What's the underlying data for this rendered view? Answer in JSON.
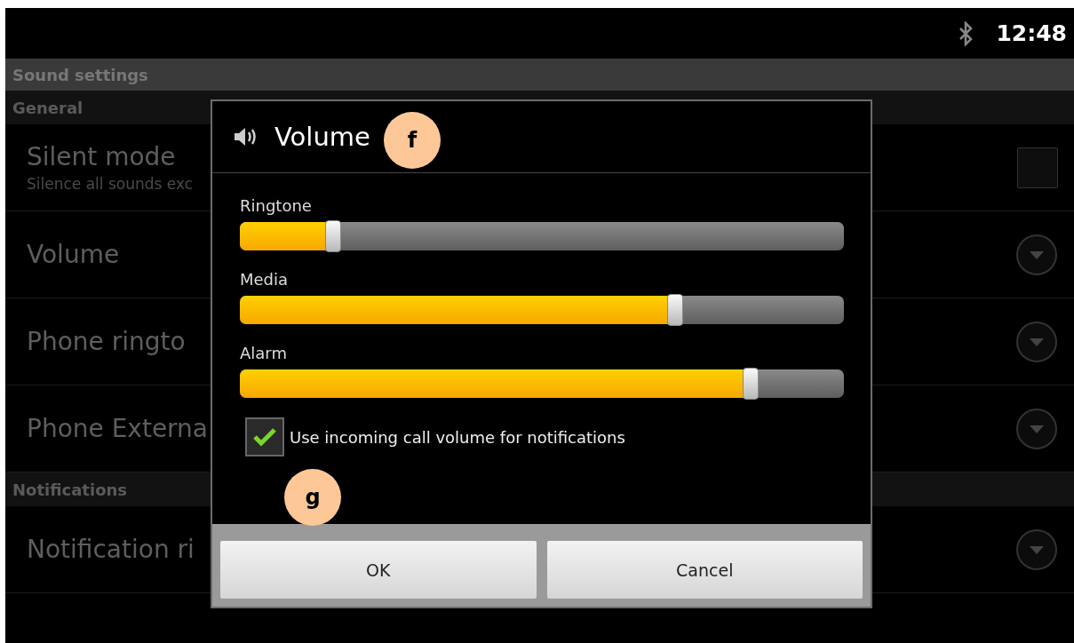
{
  "status_bar": {
    "time": "12:48"
  },
  "title_bar": {
    "title": "Sound settings"
  },
  "sections": [
    {
      "header": "General",
      "items": [
        {
          "kind": "checkbox",
          "title": "Silent mode",
          "summary": "Silence all sounds exc",
          "checked": false
        },
        {
          "kind": "list",
          "title": "Volume"
        },
        {
          "kind": "list",
          "title": "Phone ringto"
        },
        {
          "kind": "list",
          "title": "Phone Externa"
        }
      ]
    },
    {
      "header": "Notifications",
      "items": [
        {
          "kind": "list",
          "title": "Notification ri"
        }
      ]
    }
  ],
  "dialog": {
    "title": "Volume",
    "sliders": [
      {
        "label": "Ringtone",
        "level": 0.155
      },
      {
        "label": "Media",
        "level": 0.72
      },
      {
        "label": "Alarm",
        "level": 0.845
      }
    ],
    "checkbox": {
      "label": "Use incoming call volume for notifications",
      "checked": true
    },
    "buttons": [
      "OK",
      "Cancel"
    ]
  },
  "annotations": [
    {
      "label": "f"
    },
    {
      "label": "g"
    }
  ]
}
